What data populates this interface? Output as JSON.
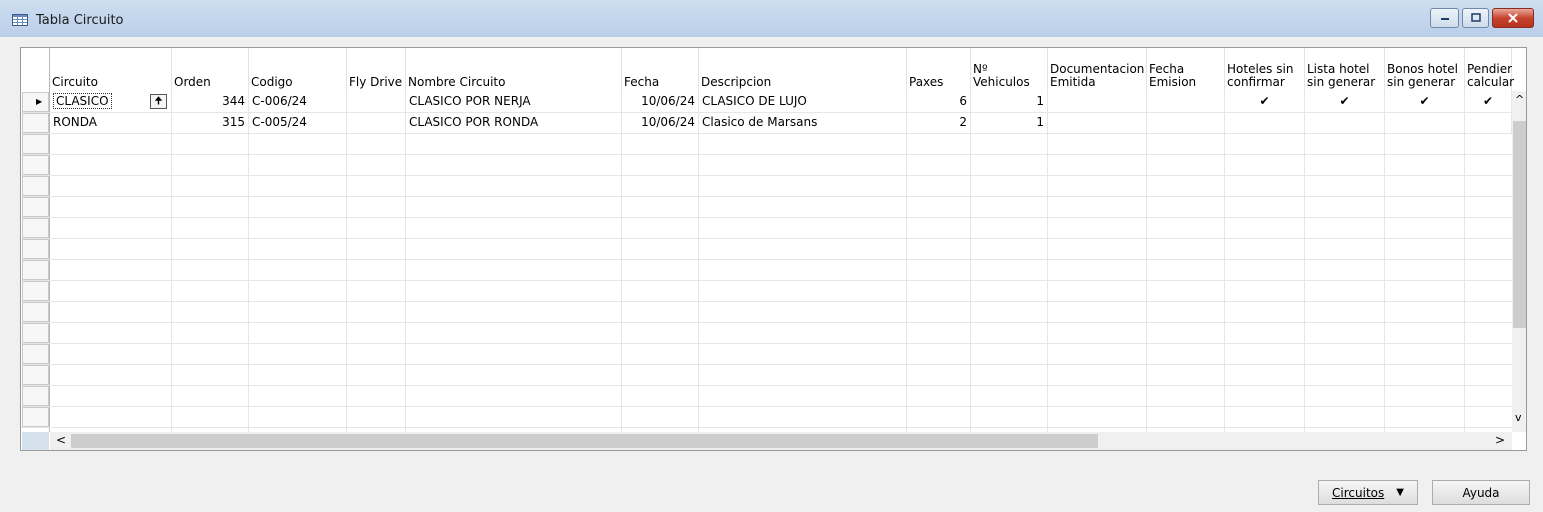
{
  "window": {
    "title": "Tabla Circuito",
    "colors": {
      "titlebar": "#c3d6ec",
      "close": "#c7452f"
    }
  },
  "grid": {
    "columns": [
      "Circuito",
      "Orden",
      "Codigo",
      "Fly Drive",
      "Nombre Circuito",
      "Fecha",
      "Descripcion",
      "Paxes",
      "Nº Vehiculos",
      "Documentacion\nEmitida",
      "Fecha\nEmision",
      "Hoteles sin\nconfirmar",
      "Lista hotel\nsin generar",
      "Bonos hotel\nsin generar",
      "Pendier\ncalcular"
    ],
    "rows": [
      {
        "circuito": "CLASICO",
        "orden": "344",
        "codigo": "C-006/24",
        "fly_drive": "",
        "nombre": "CLASICO POR NERJA",
        "fecha": "10/06/24",
        "descripcion": "CLASICO DE LUJO",
        "paxes": "6",
        "vehiculos": "1",
        "doc_emitida": "",
        "fecha_emision": "",
        "hoteles_sin_confirmar": "✔",
        "lista_hotel": "✔",
        "bonos_hotel": "✔",
        "pendiente": "✔"
      },
      {
        "circuito": "RONDA",
        "orden": "315",
        "codigo": "C-005/24",
        "fly_drive": "",
        "nombre": "CLASICO POR RONDA",
        "fecha": "10/06/24",
        "descripcion": "Clasico de Marsans",
        "paxes": "2",
        "vehiculos": "1",
        "doc_emitida": "",
        "fecha_emision": "",
        "hoteles_sin_confirmar": "",
        "lista_hotel": "",
        "bonos_hotel": "",
        "pendiente": ""
      }
    ]
  },
  "buttons": {
    "circuitos": "Circuitos",
    "ayuda": "Ayuda"
  },
  "icons": {
    "record_pointer": "▶",
    "sort_up": "🠉",
    "scroll_up": "^",
    "scroll_down": "v",
    "scroll_left": "<",
    "scroll_right": ">",
    "dropdown": "▼"
  }
}
